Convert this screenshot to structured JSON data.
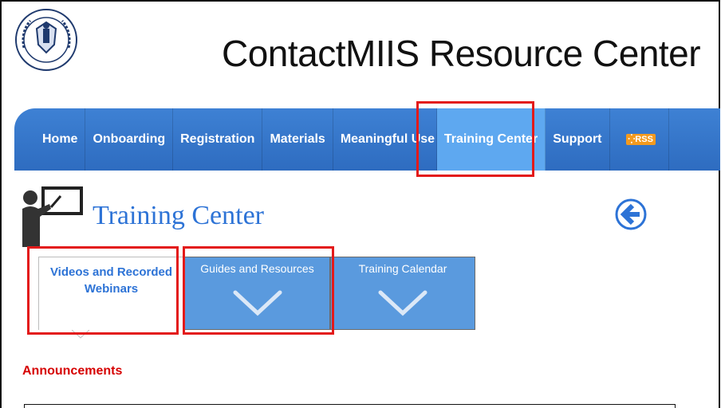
{
  "site_title": "ContactMIIS Resource Center",
  "nav": {
    "items": [
      {
        "label": "Home"
      },
      {
        "label": "Onboarding"
      },
      {
        "label": "Registration"
      },
      {
        "label": "Materials"
      },
      {
        "label": "Meaningful Use"
      },
      {
        "label": "Training Center"
      },
      {
        "label": "Support"
      }
    ],
    "rss_label": "RSS",
    "active_item": "Training Center"
  },
  "page": {
    "heading": "Training Center"
  },
  "tabs": [
    {
      "label": "Videos and Recorded Webinars",
      "active": true
    },
    {
      "label": "Guides and Resources",
      "active": false
    },
    {
      "label": "Training Calendar",
      "active": false
    }
  ],
  "announcements": {
    "title": "Announcements"
  },
  "colors": {
    "nav_bg": "#3e81d4",
    "nav_active": "#5ea8f0",
    "tab_bg": "#5a9ade",
    "link_blue": "#2d73d6",
    "announcement_red": "#d60000",
    "highlight_red": "#e31a1a",
    "rss_orange": "#f39a1e"
  },
  "icons": {
    "seal": "state-seal-icon",
    "training": "teacher-at-whiteboard-icon",
    "back": "back-arrow-icon",
    "tab_expand": "chevron-down-icon"
  }
}
